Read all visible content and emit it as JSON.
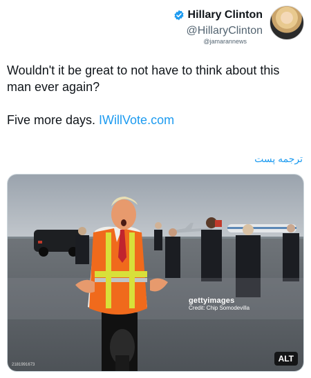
{
  "author": {
    "display_name": "Hillary Clinton",
    "handle": "@HillaryClinton",
    "verified": true,
    "avatar_icon": "profile-photo"
  },
  "watermark_top": "@jamarannews",
  "tweet": {
    "line1": "Wouldn't it be great to not have to think about this man ever again?",
    "line2_prefix": "Five more days. ",
    "link_text": "IWillVote.com"
  },
  "translate_label": "ترجمه پست",
  "media": {
    "getty_logo": "gettyimages",
    "credit": "Credit: Chip Somodevilla",
    "image_id": "2181991673",
    "alt_label": "ALT"
  },
  "colors": {
    "link": "#1d9bf0",
    "verified": "#1d9bf0",
    "text": "#0f1419",
    "secondary": "#536471"
  }
}
